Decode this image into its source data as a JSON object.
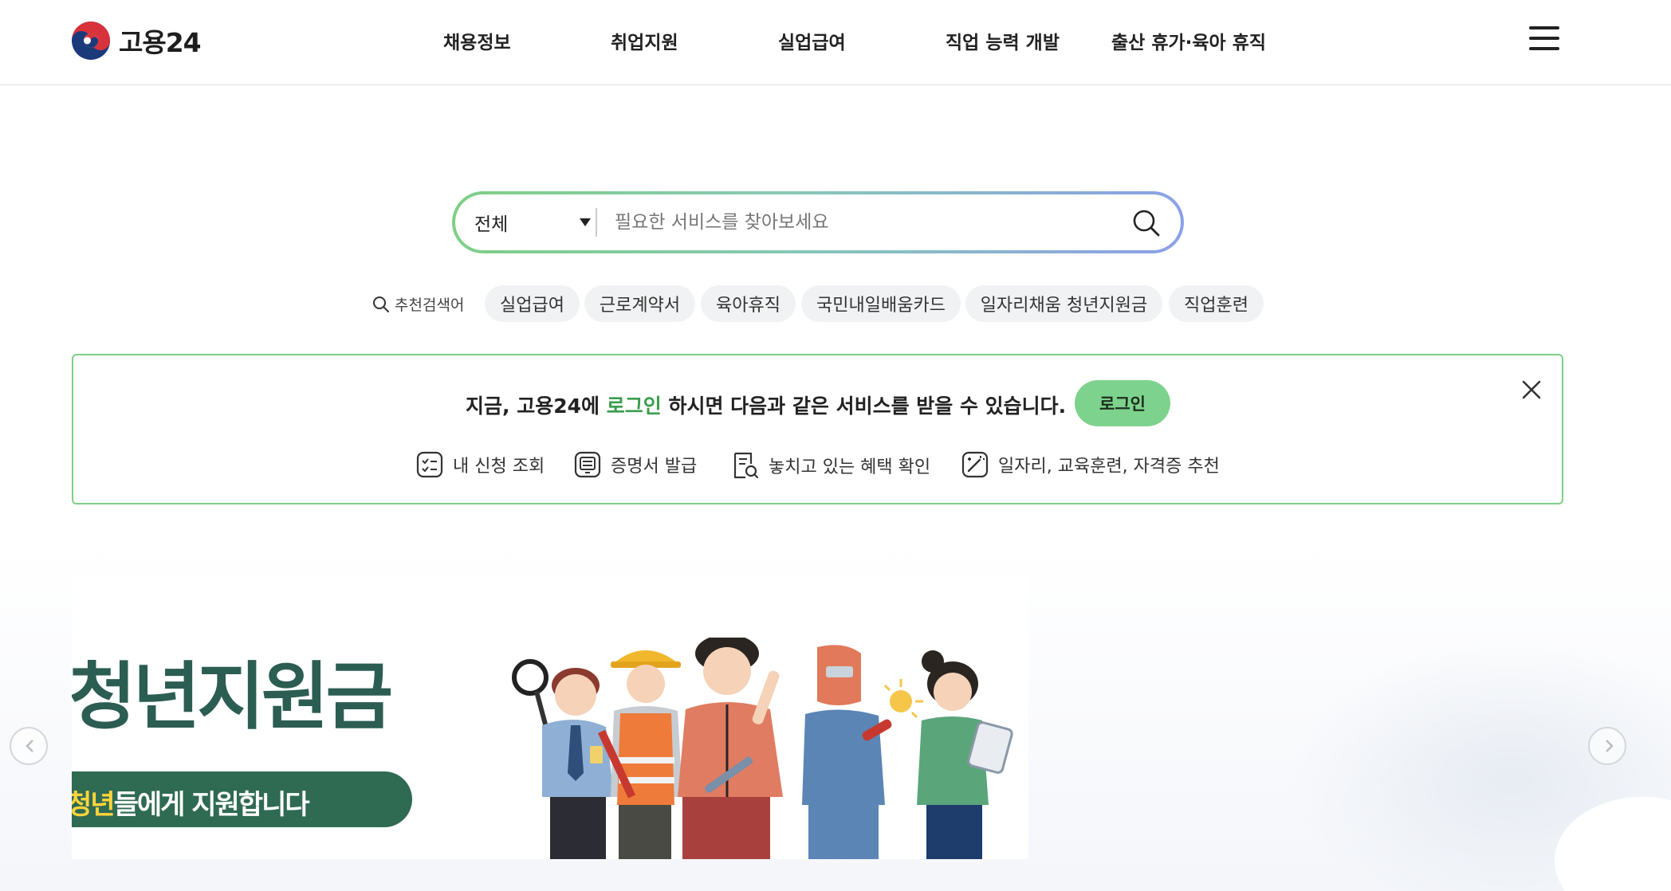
{
  "header": {
    "logo_text": "고용24",
    "nav": [
      "채용정보",
      "취업지원",
      "실업급여",
      "직업 능력 개발",
      "출산 휴가·육아 휴직"
    ]
  },
  "search": {
    "scope": "전체",
    "placeholder": "필요한 서비스를 찾아보세요"
  },
  "recommended": {
    "label": "추천검색어",
    "keywords": [
      "실업급여",
      "근로계약서",
      "육아휴직",
      "국민내일배움카드",
      "일자리채움 청년지원금",
      "직업훈련"
    ]
  },
  "login_banner": {
    "message_before": "지금, 고용24에",
    "message_highlight": "로그인",
    "message_after": "하시면 다음과 같은 서비스를 받을 수 있습니다.",
    "login_button": "로그인",
    "services": [
      "내 신청 조회",
      "증명서 발급",
      "놓치고 있는 혜택 확인",
      "일자리, 교육훈련, 자격증 추천"
    ]
  },
  "hero": {
    "title": "청년지원금",
    "subtitle_partial": "청년",
    "subtitle_rest": "들에게 지원합니다"
  },
  "colors": {
    "brand_green": "#7dd38d",
    "highlight_green": "#3a9d4e",
    "search_gradient": [
      "#7fcf86",
      "#8ba0e8"
    ],
    "hero_title": "#2c5d52"
  }
}
